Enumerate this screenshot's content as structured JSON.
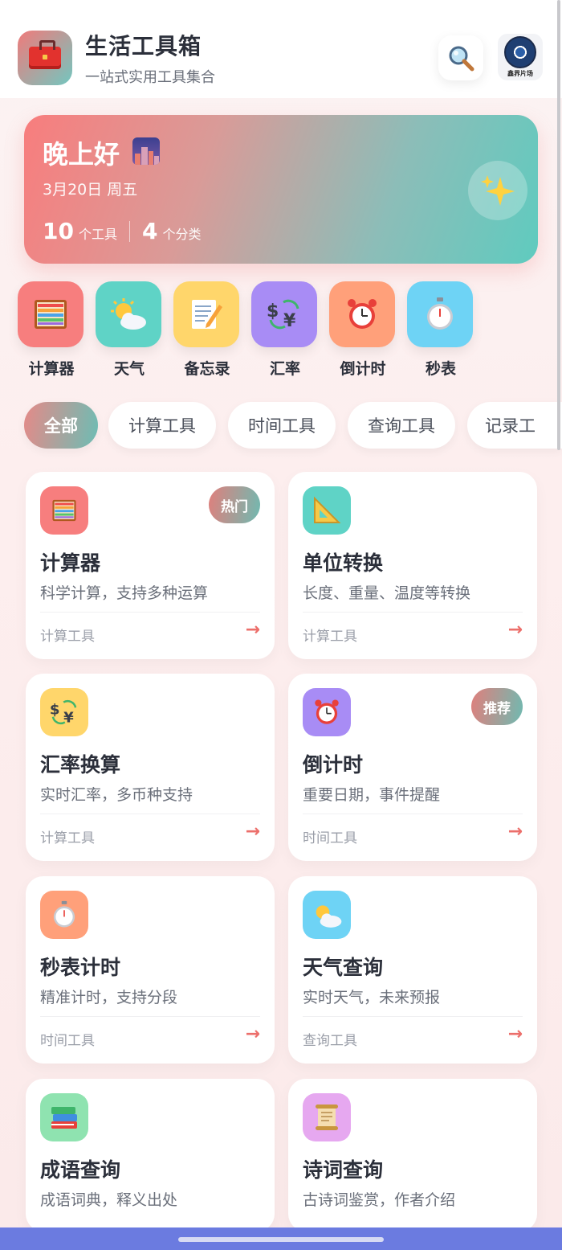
{
  "header": {
    "title": "生活工具箱",
    "subtitle": "一站式实用工具集合",
    "avatar_caption": "鑫界片场"
  },
  "greeting": {
    "title": "晚上好",
    "date": "3月20日 周五",
    "tools_count": "10",
    "tools_unit": "个工具",
    "categories_count": "4",
    "categories_unit": "个分类"
  },
  "quick_tools": [
    {
      "label": "计算器",
      "icon": "abacus-icon",
      "color": "#f77e7e"
    },
    {
      "label": "天气",
      "icon": "sun-cloud-icon",
      "color": "#5fd3c6"
    },
    {
      "label": "备忘录",
      "icon": "memo-icon",
      "color": "#ffd66b"
    },
    {
      "label": "汇率",
      "icon": "currency-exchange-icon",
      "color": "#a88cf5"
    },
    {
      "label": "倒计时",
      "icon": "alarm-clock-icon",
      "color": "#ffa07a"
    },
    {
      "label": "秒表",
      "icon": "stopwatch-icon",
      "color": "#6ed3f5"
    }
  ],
  "tabs": [
    "全部",
    "计算工具",
    "时间工具",
    "查询工具",
    "记录工"
  ],
  "cards": [
    {
      "title": "计算器",
      "desc": "科学计算，支持多种运算",
      "category": "计算工具",
      "badge": "热门",
      "icon": "abacus-icon",
      "color": "#f77e7e"
    },
    {
      "title": "单位转换",
      "desc": "长度、重量、温度等转换",
      "category": "计算工具",
      "badge": "",
      "icon": "triangle-ruler-icon",
      "color": "#5fd3c6"
    },
    {
      "title": "汇率换算",
      "desc": "实时汇率，多币种支持",
      "category": "计算工具",
      "badge": "",
      "icon": "currency-exchange-icon",
      "color": "#ffd66b"
    },
    {
      "title": "倒计时",
      "desc": "重要日期，事件提醒",
      "category": "时间工具",
      "badge": "推荐",
      "icon": "alarm-clock-icon",
      "color": "#a88cf5"
    },
    {
      "title": "秒表计时",
      "desc": "精准计时，支持分段",
      "category": "时间工具",
      "badge": "",
      "icon": "stopwatch-icon",
      "color": "#ffa07a"
    },
    {
      "title": "天气查询",
      "desc": "实时天气，未来预报",
      "category": "查询工具",
      "badge": "",
      "icon": "sun-cloud-icon",
      "color": "#6ed3f5"
    },
    {
      "title": "成语查询",
      "desc": "成语词典，释义出处",
      "category": "",
      "badge": "",
      "icon": "books-icon",
      "color": "#8fe3b0"
    },
    {
      "title": "诗词查询",
      "desc": "古诗词鉴赏，作者介绍",
      "category": "",
      "badge": "",
      "icon": "scroll-icon",
      "color": "#e6a8f0"
    }
  ],
  "arrow": "→"
}
